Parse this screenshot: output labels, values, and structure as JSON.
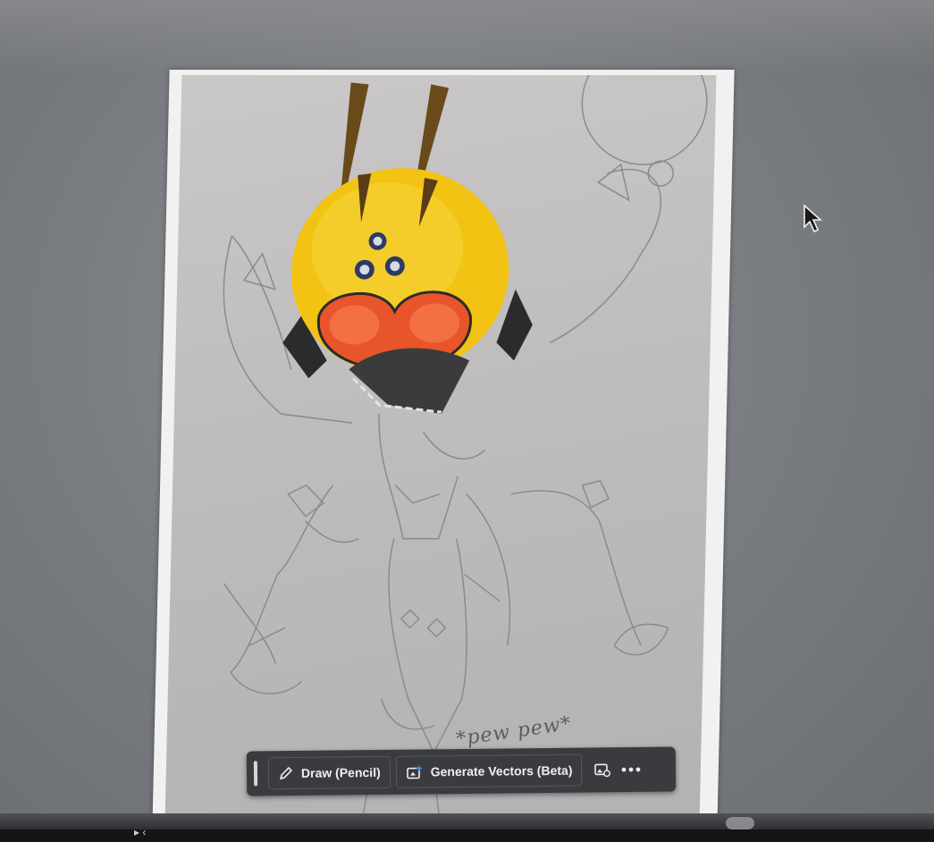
{
  "canvas": {
    "background": "#7a7d82",
    "sketch_caption": "*pew pew*"
  },
  "artwork": {
    "head_color": "#f2c313",
    "eye_color": "#e8552a",
    "antenna_color": "#6a4a1a"
  },
  "toolbar": {
    "draw_label": "Draw (Pencil)",
    "draw_icon": "pencil-icon",
    "generate_label": "Generate Vectors (Beta)",
    "generate_icon": "sparkle-image-icon",
    "image_icon": "image-settings-icon",
    "more_icon": "more-horizontal-icon"
  },
  "status_bar": {
    "glyph": "▸ ‹"
  }
}
